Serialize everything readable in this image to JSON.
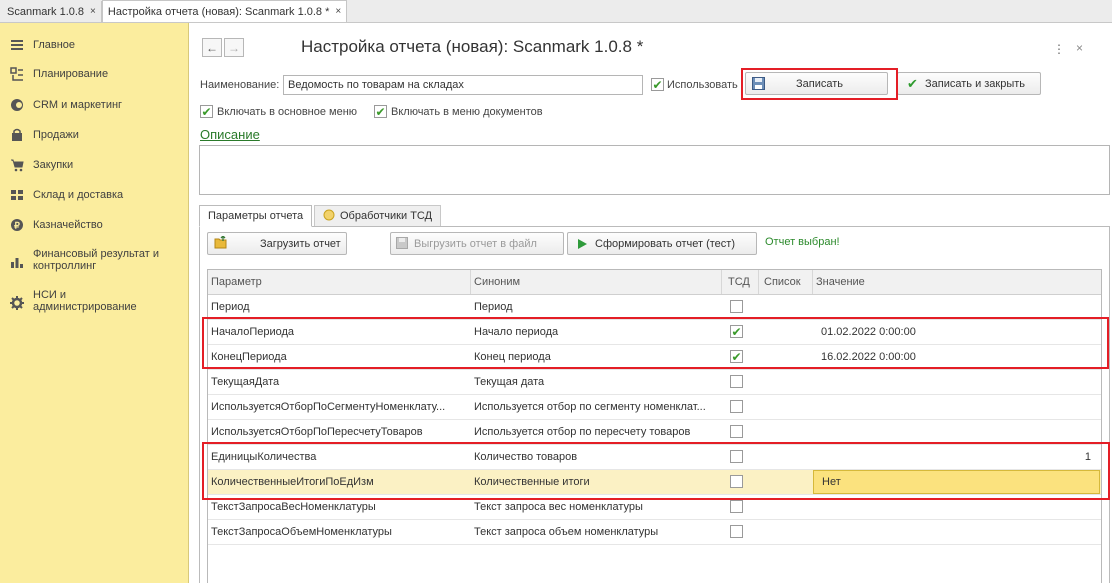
{
  "app_tabs": [
    {
      "label": "Scanmark 1.0.8",
      "close": "×"
    },
    {
      "label": "Настройка отчета (новая): Scanmark 1.0.8 *",
      "close": "×"
    }
  ],
  "sidebar": {
    "items": [
      {
        "label": "Главное",
        "icon": "menu-icon"
      },
      {
        "label": "Планирование",
        "icon": "planning-icon"
      },
      {
        "label": "CRM и маркетинг",
        "icon": "crm-icon"
      },
      {
        "label": "Продажи",
        "icon": "sales-bag-icon"
      },
      {
        "label": "Закупки",
        "icon": "cart-icon"
      },
      {
        "label": "Склад и доставка",
        "icon": "warehouse-icon"
      },
      {
        "label": "Казначейство",
        "icon": "treasury-icon"
      },
      {
        "label": "Финансовый результат и контроллинг",
        "icon": "bar-chart-icon"
      },
      {
        "label": "НСИ и администрирование",
        "icon": "gear-icon"
      }
    ]
  },
  "form": {
    "back": "←",
    "forward": "→",
    "title": "Настройка отчета (новая): Scanmark 1.0.8 *",
    "more": "⋮",
    "close": "×",
    "name_label": "Наименование:",
    "name_value": "Ведомость по товарам на складах",
    "use_label": "Использовать",
    "save_label": "Записать",
    "save_close_label": "Записать и закрыть",
    "include_main_menu_label": "Включать в основное меню",
    "include_docs_menu_label": "Включать в меню документов",
    "description_label": "Описание"
  },
  "tabs": [
    {
      "label": "Параметры отчета"
    },
    {
      "label": "Обработчики ТСД"
    }
  ],
  "toolbar": {
    "load_label": "Загрузить отчет",
    "export_label": "Выгрузить отчет в файл",
    "generate_label": "Сформировать отчет (тест)",
    "status": "Отчет выбран!"
  },
  "table": {
    "columns": [
      "Параметр",
      "Синоним",
      "ТСД",
      "Список",
      "Значение"
    ],
    "rows": [
      {
        "param": "Период",
        "synonym": "Период",
        "tsd": false,
        "value": ""
      },
      {
        "param": "НачалоПериода",
        "synonym": "Начало периода",
        "tsd": true,
        "value": "01.02.2022 0:00:00"
      },
      {
        "param": "КонецПериода",
        "synonym": "Конец периода",
        "tsd": true,
        "value": "16.02.2022 0:00:00"
      },
      {
        "param": "ТекущаяДата",
        "synonym": "Текущая дата",
        "tsd": false,
        "value": ""
      },
      {
        "param": "ИспользуетсяОтборПоСегментуНоменклату...",
        "synonym": "Используется отбор по сегменту номенклат...",
        "tsd": false,
        "value": ""
      },
      {
        "param": "ИспользуетсяОтборПоПересчетуТоваров",
        "synonym": "Используется отбор по пересчету товаров",
        "tsd": false,
        "value": ""
      },
      {
        "param": "ЕдиницыКоличества",
        "synonym": "Количество товаров",
        "tsd": false,
        "value": "1"
      },
      {
        "param": "КоличественныеИтогиПоЕдИзм",
        "synonym": "Количественные итоги",
        "tsd": false,
        "value": "Нет"
      },
      {
        "param": "ТекстЗапросаВесНоменклатуры",
        "synonym": "Текст запроса вес номенклатуры",
        "tsd": false,
        "value": ""
      },
      {
        "param": "ТекстЗапросаОбъемНоменклатуры",
        "synonym": "Текст запроса объем номенклатуры",
        "tsd": false,
        "value": ""
      }
    ]
  },
  "colors": {
    "sidebar_bg": "#fbed9e",
    "highlight_red": "#e41e26",
    "check_green": "#3a9a2a",
    "selected_row": "#fbf1c4",
    "active_cell": "#fbe27e"
  }
}
